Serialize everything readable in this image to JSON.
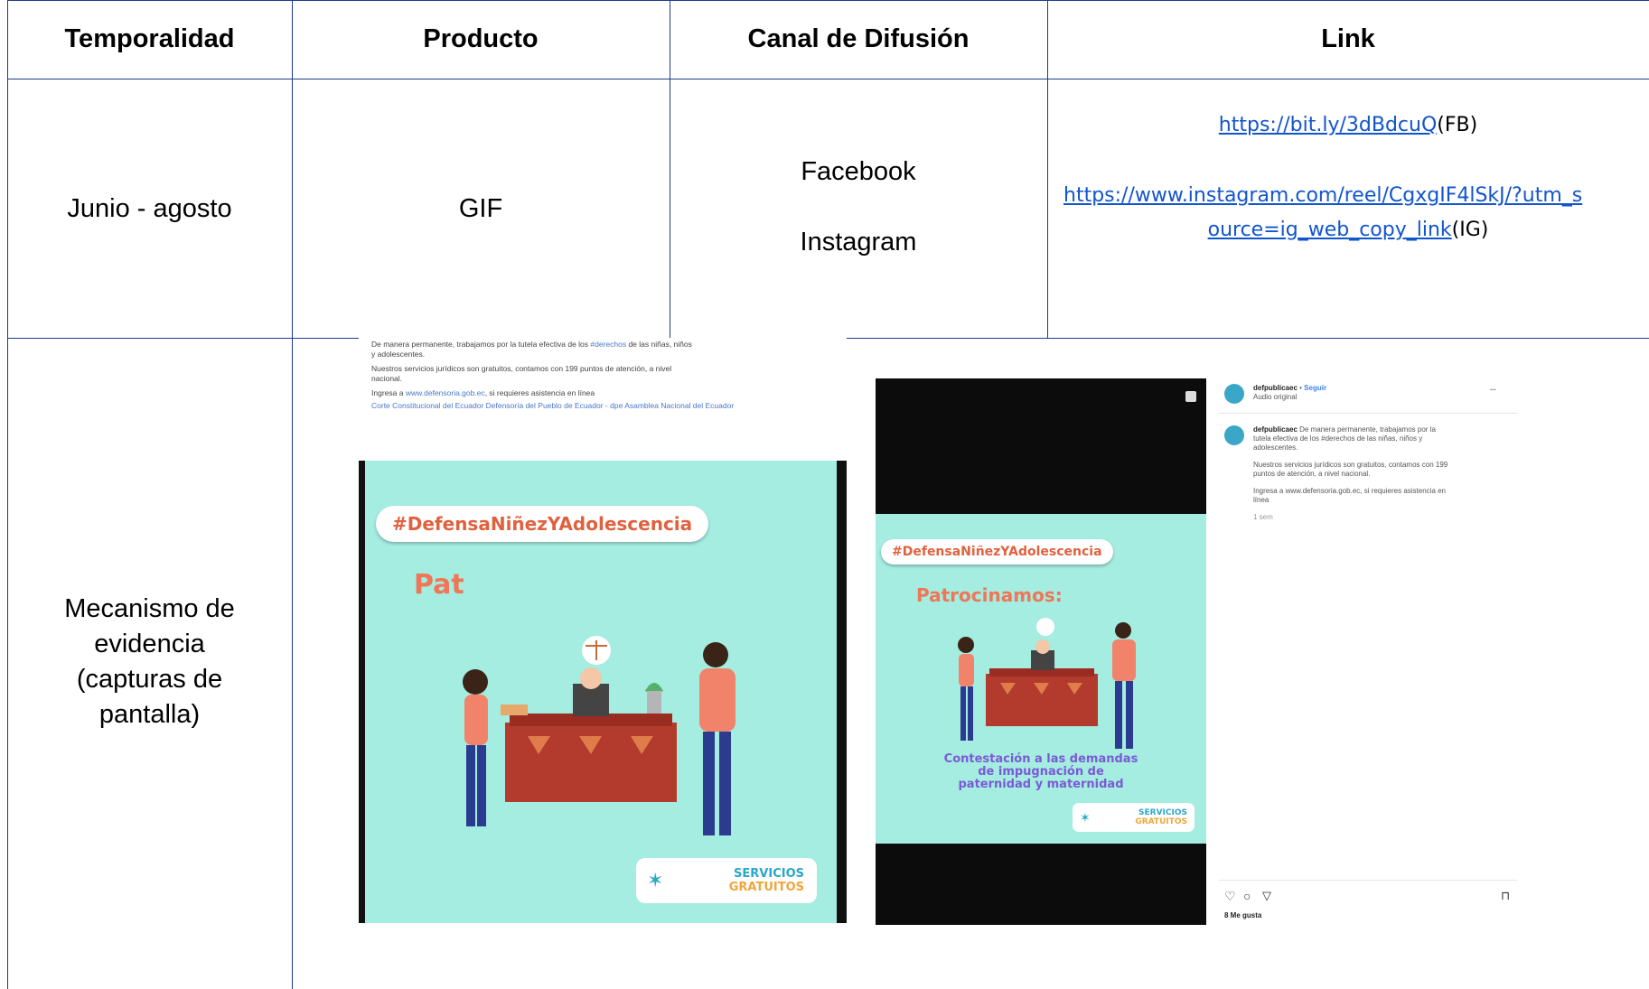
{
  "table": {
    "headers": {
      "temporalidad": "Temporalidad",
      "producto": "Producto",
      "canal": "Canal de Difusión",
      "link": "Link"
    },
    "row1": {
      "temporalidad": "Junio - agosto",
      "producto": "GIF",
      "canal_1": "Facebook",
      "canal_2": "Instagram",
      "link_fb": "https://bit.ly/3dBdcuQ",
      "link_fb_suffix": "(FB)",
      "link_ig_line1": "https://www.instagram.com/reel/CgxgIF4lSkJ/?utm_s",
      "link_ig_line2": "ource=ig_web_copy_link",
      "link_ig_suffix": "(IG)"
    },
    "row2": {
      "label_1": "Mecanismo de",
      "label_2": "evidencia",
      "label_3": "(capturas de",
      "label_4": "pantalla)"
    }
  },
  "facebook_capture": {
    "line1_a": "De manera permanente, trabajamos por la tutela efectiva de los ",
    "line1_tag": "#derechos",
    "line1_b": " de las niñas, niños",
    "line2": "y adolescentes.",
    "line3": "Nuestros servicios jurídicos son gratuitos, contamos con 199 puntos de atención, a nivel",
    "line4": "nacional.",
    "line5_a": "Ingresa a ",
    "line5_link": "www.defensoria.gob.ec",
    "line5_b": ", si requieres asistencia en línea",
    "mentions": "Corte Constitucional del Ecuador Defensoría del Pueblo de Ecuador - dpe Asamblea Nacional del Ecuador",
    "hashtag": "#DefensaNiñezYAdolescencia",
    "heading": "Pat",
    "logo_text_1": "SERVICIOS",
    "logo_text_2": "GRATUITOS"
  },
  "instagram_capture": {
    "hashtag": "#DefensaNiñezYAdolescencia",
    "heading": "Patrocinamos:",
    "caption_1": "Contestación a las demandas",
    "caption_2": "de impugnación de",
    "caption_3": "paternidad y maternidad",
    "logo_text_1": "SERVICIOS",
    "logo_text_2": "GRATUITOS",
    "account": "defpublicaec",
    "follow": "Seguir",
    "audio": "Audio original",
    "comment_1": "De manera permanente, trabajamos por la",
    "comment_2": "tutela efectiva de los #derechos de las niñas, niños y",
    "comment_3": "adolescentes.",
    "comment_4": "Nuestros servicios jurídicos son gratuitos, contamos con 199",
    "comment_5": "puntos de atención, a nivel nacional.",
    "comment_6": "Ingresa a www.defensoria.gob.ec, si requieres asistencia en",
    "comment_7": "línea",
    "time": "1 sem",
    "likes": "8 Me gusta",
    "more": "..."
  },
  "colors": {
    "border": "#1f3a8a",
    "link": "#1155cc",
    "poster_bg": "#a5ece1",
    "tag_text": "#e0613e"
  }
}
